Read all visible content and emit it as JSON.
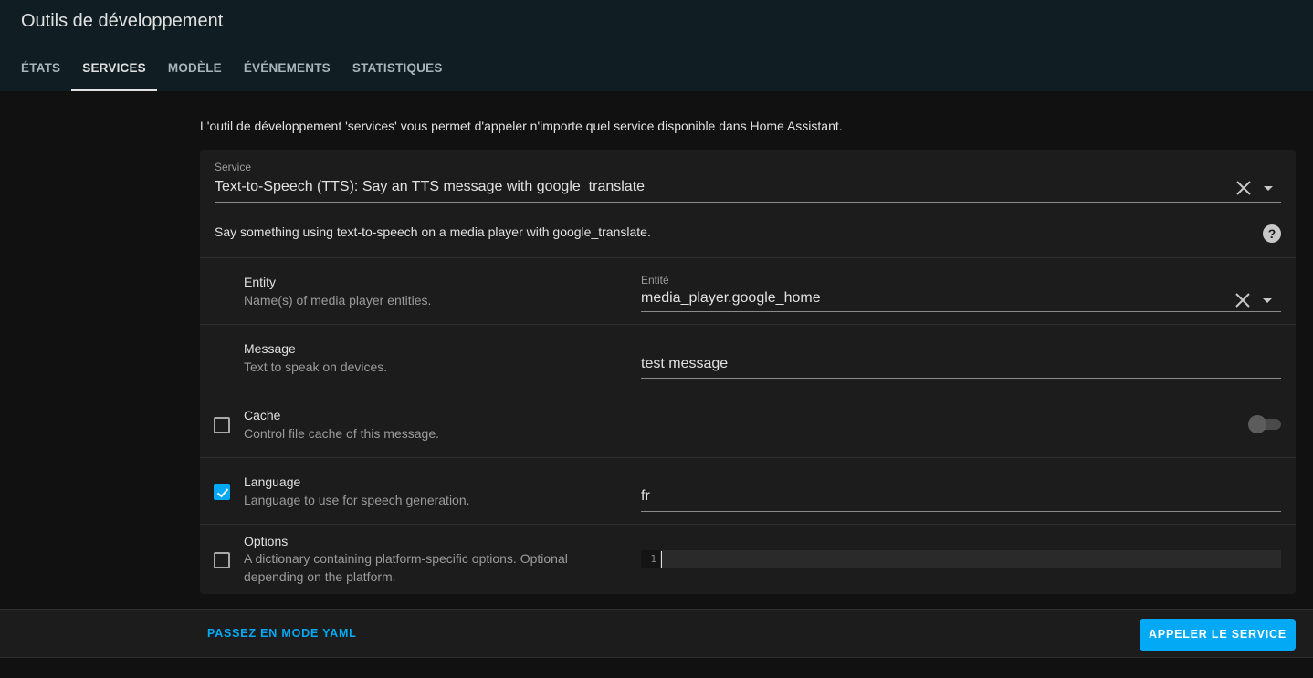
{
  "header": {
    "title": "Outils de développement",
    "tabs": [
      {
        "label": "ÉTATS",
        "active": false
      },
      {
        "label": "SERVICES",
        "active": true
      },
      {
        "label": "MODÈLE",
        "active": false
      },
      {
        "label": "ÉVÉNEMENTS",
        "active": false
      },
      {
        "label": "STATISTIQUES",
        "active": false
      }
    ]
  },
  "intro": "L'outil de développement 'services' vous permet d'appeler n'importe quel service disponible dans Home Assistant.",
  "service": {
    "label": "Service",
    "value": "Text-to-Speech (TTS): Say an TTS message with google_translate",
    "description": "Say something using text-to-speech on a media player with google_translate."
  },
  "fields": {
    "entity": {
      "name": "Entity",
      "description": "Name(s) of media player entities.",
      "input_label": "Entité",
      "value": "media_player.google_home"
    },
    "message": {
      "name": "Message",
      "description": "Text to speak on devices.",
      "value": "test message"
    },
    "cache": {
      "name": "Cache",
      "description": "Control file cache of this message.",
      "checked": false,
      "toggle_on": false
    },
    "language": {
      "name": "Language",
      "description": "Language to use for speech generation.",
      "checked": true,
      "value": "fr"
    },
    "options": {
      "name": "Options",
      "description_line1": "A dictionary containing platform-specific options. Optional",
      "description_line2": "depending on the platform.",
      "checked": false,
      "line_number": "1"
    }
  },
  "footer": {
    "yaml_label": "PASSEZ EN MODE YAML",
    "call_label": "APPELER LE SERVICE"
  },
  "colors": {
    "accent": "#03a9f4",
    "header_bg": "#101e24",
    "card_bg": "#1c1c1c",
    "page_bg": "#111111"
  },
  "icons": {
    "clear": "close-icon",
    "dropdown": "menu-down-icon",
    "help": "help-circle-icon",
    "check": "checkmark-icon"
  }
}
